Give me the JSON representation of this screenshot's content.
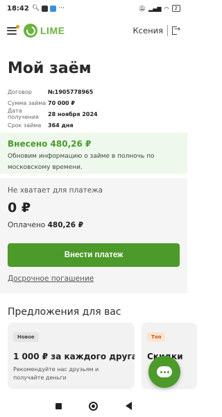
{
  "status_bar": {
    "time": "18:42",
    "battery": "2"
  },
  "header": {
    "logo_text": "LIME",
    "user_name": "Ксения"
  },
  "loan": {
    "title": "Мой заём",
    "rows": [
      {
        "label": "Договор",
        "value": "№1905778965"
      },
      {
        "label": "Сумма займа",
        "value": "70 000 ₽"
      },
      {
        "label": "Дата получения",
        "value": "28 ноября 2024"
      },
      {
        "label": "Срок займа",
        "value": "364 дня"
      }
    ]
  },
  "paid_panel": {
    "amount": "Внесено 480,26 ₽",
    "note": "Обновим информацию о займе в полночь по московскому времени."
  },
  "payment": {
    "lack_label": "Не хватает для платежа",
    "lack_amount": "0 ₽",
    "paid_label": "Оплачено",
    "paid_value": "480,26 ₽",
    "button_label": "Внести платеж",
    "early_link": "Досрочное погашение"
  },
  "offers": {
    "title": "Предложения для вас",
    "cards": [
      {
        "badge": "Новое",
        "head": "1 000 ₽ за каждого друга",
        "sub": "Рекомендуйте нас друзьям и получайте деньги"
      },
      {
        "badge": "Топ",
        "head": "Скидки",
        "sub": ""
      }
    ]
  },
  "colors": {
    "brand": "#6cb33f",
    "button": "#4c9a2a",
    "panel": "#eef8ec"
  }
}
